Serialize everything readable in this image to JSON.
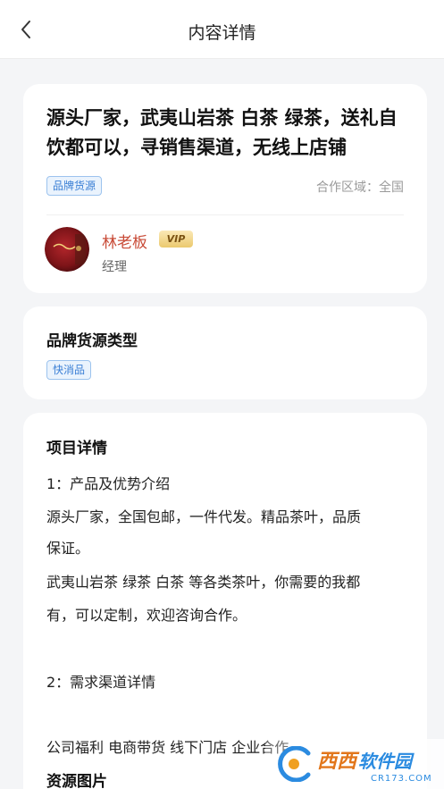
{
  "header": {
    "title": "内容详情"
  },
  "listing": {
    "headline": "源头厂家，武夷山岩茶 白茶 绿茶，送礼自饮都可以，寻销售渠道，无线上店铺",
    "tag": "品牌货源",
    "region": "合作区域：全国",
    "publisher": {
      "name": "林老板",
      "vip": "VIP",
      "role": "经理"
    }
  },
  "brand_type": {
    "title": "品牌货源类型",
    "tag": "快消品"
  },
  "details": {
    "title": "项目详情",
    "lines": [
      "1：产品及优势介绍",
      "源头厂家，全国包邮，一件代发。精品茶叶，品质",
      "保证。",
      "武夷山岩茶 绿茶 白茶 等各类茶叶，你需要的我都",
      "有，可以定制，欢迎咨询合作。",
      "2：需求渠道详情",
      "公司福利 电商带货 线下门店 企业合作",
      "资源图片"
    ]
  },
  "watermark": {
    "brand": "西西",
    "suffix": "软件园",
    "url": "CR173.COM"
  },
  "colors": {
    "accent": "#3a7fd5",
    "name": "#c84a36",
    "vip": "#ebc96e"
  }
}
